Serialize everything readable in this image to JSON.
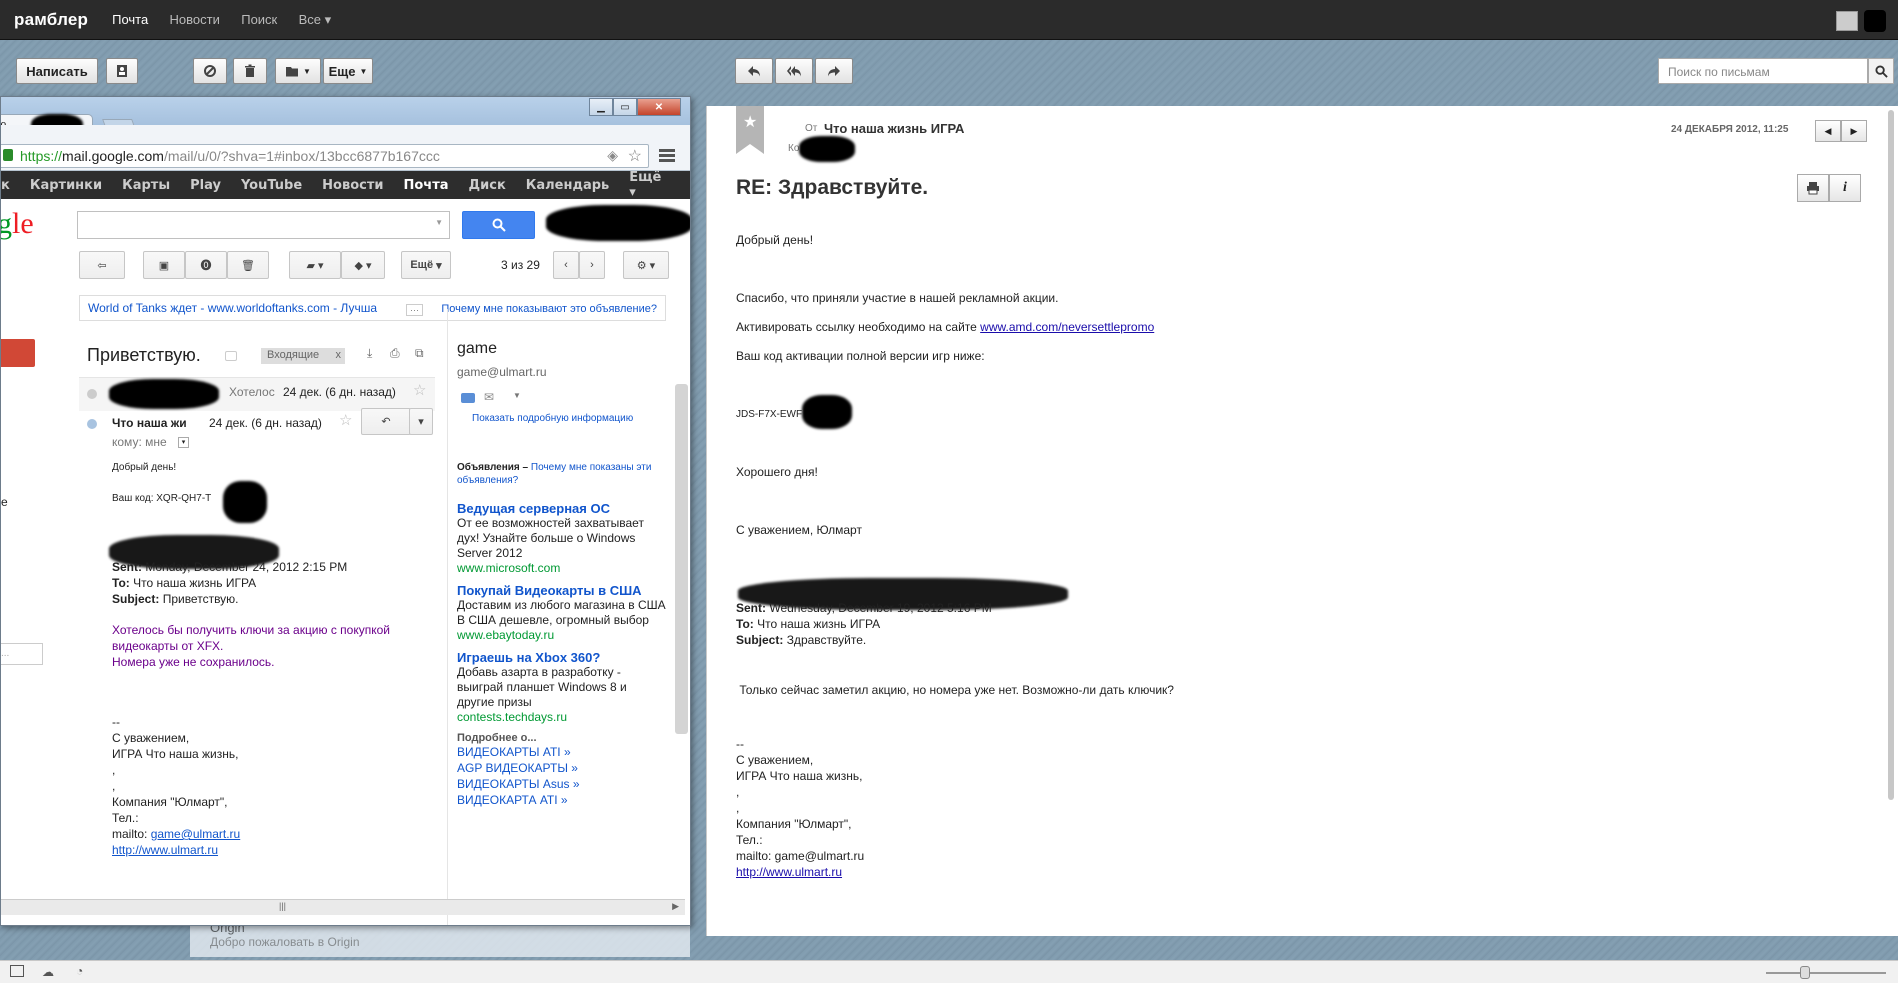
{
  "rambler": {
    "logo": "рамблер",
    "nav": [
      "Почта",
      "Новости",
      "Поиск",
      "Все ▾"
    ],
    "toolbar": {
      "compose": "Написать",
      "more": "Еще"
    },
    "search_placeholder": "Поиск по письмам",
    "message": {
      "from_label": "От",
      "from_name": "Что наша жизнь ИГРА",
      "to_label": "Ко",
      "date": "24 ДЕКАБРЯ 2012, 11:25",
      "subject": "RE: Здравствуйте.",
      "greeting": "Добрый день!",
      "thanks": "Спасибо, что приняли участие в нашей рекламной акции.",
      "activate_prefix": "Активировать ссылку необходимо на сайте ",
      "activate_link": "www.amd.com/neversettlepromo",
      "code_intro": "Ваш код активации полной версии игр ниже:",
      "code": "JDS-F7X-EWF",
      "goodbye": "Хорошего дня!",
      "regards": "С уважением, Юлмарт",
      "sent_label": "Sent:",
      "sent_value": "Wednesday, December 19, 2012 5:16 PM",
      "to_hdr_label": "To:",
      "to_hdr_value": "Что наша жизнь ИГРА",
      "subj_hdr_label": "Subject:",
      "subj_hdr_value": "Здравствуйте.",
      "quote": " Только сейчас заметил акцию, но номера уже нет. Возможно-ли дать ключик?",
      "sig_dash": "--",
      "sig_regards": "С уважением,",
      "sig_name": "ИГРА Что наша жизнь,",
      "sig_comma": ",",
      "sig_company": "Компания \"Юлмарт\",",
      "sig_tel": "Тел.:",
      "sig_mailto": "mailto: game@ulmart.ru",
      "sig_url": "http://www.ulmart.ru"
    }
  },
  "chrome": {
    "tab_title": "ю.",
    "tab_close": "x",
    "url_scheme": "https://",
    "url_host": "mail.google.com",
    "url_path": "/mail/u/0/?shva=1#inbox/13bcc6877b167ccc",
    "gbar": [
      "Картинки",
      "Карты",
      "Play",
      "YouTube",
      "Новости",
      "Почта",
      "Диск",
      "Календарь",
      "Ещё ▾"
    ],
    "logo": "gle",
    "more_btn": "Ещё",
    "pager": "3 из 29",
    "ad_text": "World of Tanks ждет - www.worldoftanks.com - Лучша",
    "ad_why": "Почему мне показывают это объявление?",
    "thread_title": "Приветствую.",
    "label_inbox": "Входящие",
    "label_x": "x",
    "msg1_snippet": "Хотелос",
    "msg1_date": "24 дек. (6 дн. назад)",
    "msg2_from": "Что наша жи",
    "msg2_date": "24 дек. (6 дн. назад)",
    "msg2_to": "кому: мне",
    "body_greeting": "Добрый день!",
    "body_code": "Ваш код: XQR-QH7-T",
    "sent_label": "Sent:",
    "sent_value": "Monday, December 24, 2012 2:15 PM",
    "to_label": "To:",
    "to_value": "Что наша жизнь ИГРА",
    "subject_label": "Subject:",
    "subject_value": "Приветствую.",
    "quote1": "Хотелось бы получить ключи за акцию с покупкой",
    "quote2": "видеокарты от XFX.",
    "quote3": "Номера уже не сохранилось.",
    "sig_dash": "--",
    "sig_regards": "С уважением,",
    "sig_name": "ИГРА Что наша жизнь,",
    "sig_comma": ",",
    "sig_comma2": ",",
    "sig_company": "Компания \"Юлмарт\",",
    "sig_tel": "Тел.:",
    "sig_mailto_prefix": "mailto: ",
    "sig_mailto": "game@ulmart.ru",
    "sig_url": "http://www.ulmart.ru",
    "contact_name": "game",
    "contact_email": "game@ulmart.ru",
    "contact_more": "Показать подробную информацию",
    "ads_header": "Объявления – ",
    "ads_why": "Почему мне показаны эти объявления?",
    "ads": [
      {
        "title": "Ведущая серверная ОС",
        "text": "От ее возможностей захватывает дух! Узнайте больше о Windows Server 2012",
        "url": "www.microsoft.com"
      },
      {
        "title": "Покупай Видеокарты в США",
        "text": "Доставим из любого магазина в США В США дешевле, огромный выбор",
        "url": "www.ebaytoday.ru"
      },
      {
        "title": "Играешь на Xbox 360?",
        "text": "Добавь азарта в разработку - выиграй планшет Windows 8 и другие призы",
        "url": "contests.techdays.ru"
      }
    ],
    "more_header": "Подробнее о...",
    "more_links": [
      "ВИДЕОКАРТЫ ATI »",
      "AGP ВИДЕОКАРТЫ »",
      "ВИДЕОКАРТЫ Asus »",
      "ВИДЕОКАРТА ATI »"
    ],
    "left_e": "е",
    "left_dots": "..."
  },
  "behind": {
    "line1": "Origin",
    "line2": "Добро пожаловать в Origin"
  }
}
